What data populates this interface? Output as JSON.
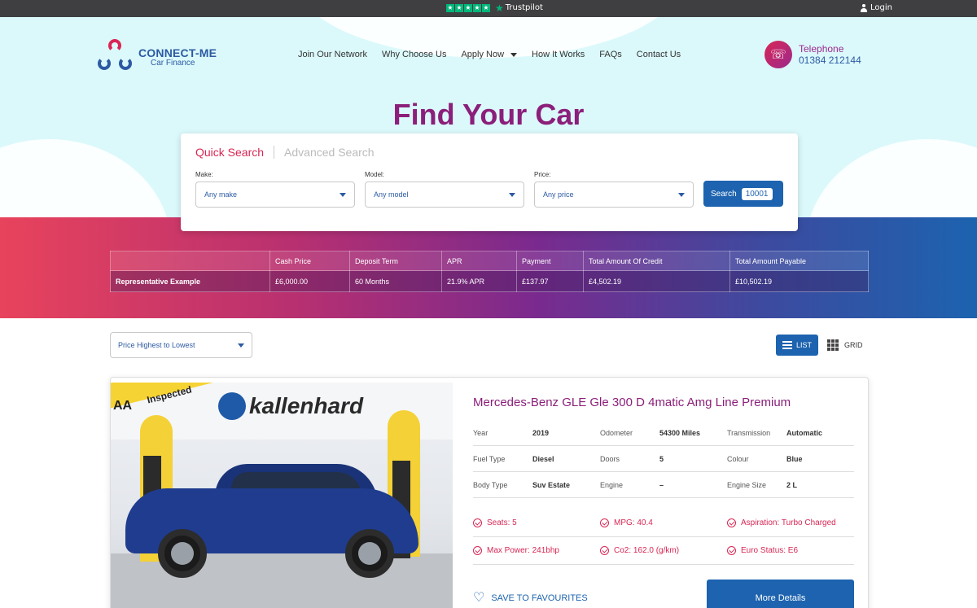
{
  "topbar": {
    "trustpilot": "Trustpilot",
    "login": "Login"
  },
  "brand": {
    "name": "CONNECT-ME",
    "tagline": "Car Finance",
    "colors": {
      "primary_blue": "#1d63af",
      "accent_pink": "#d92654",
      "purple": "#8b1f7a",
      "hero_bg": "#dbf9fb"
    }
  },
  "nav": {
    "items": [
      {
        "label": "Join Our Network"
      },
      {
        "label": "Why Choose Us"
      },
      {
        "label": "Apply Now"
      },
      {
        "label": "How It Works"
      },
      {
        "label": "FAQs"
      },
      {
        "label": "Contact Us"
      }
    ]
  },
  "contact": {
    "label": "Telephone",
    "number": "01384 212144"
  },
  "hero": {
    "title": "Find Your Car"
  },
  "search": {
    "tab_quick": "Quick Search",
    "tab_advanced": "Advanced Search",
    "make_label": "Make:",
    "make_value": "Any make",
    "model_label": "Model:",
    "model_value": "Any model",
    "price_label": "Price:",
    "price_value": "Any price",
    "button_label": "Search",
    "count": "10001"
  },
  "representative": {
    "headers": [
      "",
      "Cash Price",
      "Deposit Term",
      "APR",
      "Payment",
      "Total Amount Of Credit",
      "Total Amount Payable"
    ],
    "row": [
      "Representative Example",
      "£6,000.00",
      "60 Months",
      "21.9% APR",
      "£137.97",
      "£4,502.19",
      "£10,502.19"
    ]
  },
  "toolbar": {
    "sort_value": "Price Highest to Lowest",
    "list_label": "LIST",
    "grid_label": "GRID"
  },
  "listing": {
    "photo_text": {
      "ribbon": "Inspected",
      "badge": "AA",
      "dealer": "kallenhard"
    },
    "title": "Mercedes-Benz GLE Gle 300 D 4matic Amg Line Premium",
    "specs": [
      [
        [
          "Year",
          "2019"
        ],
        [
          "Odometer",
          "54300 Miles"
        ],
        [
          "Transmission",
          "Automatic"
        ]
      ],
      [
        [
          "Fuel Type",
          "Diesel"
        ],
        [
          "Doors",
          "5"
        ],
        [
          "Colour",
          "Blue"
        ]
      ],
      [
        [
          "Body Type",
          "Suv Estate"
        ],
        [
          "Engine",
          "–"
        ],
        [
          "Engine Size",
          "2 L"
        ]
      ]
    ],
    "features": [
      [
        "Seats: 5",
        "MPG: 40.4",
        "Aspiration: Turbo Charged"
      ],
      [
        "Max Power: 241bhp",
        "Co2: 162.0 (g/km)",
        "Euro Status: E6"
      ]
    ],
    "favourite_label": "SAVE TO FAVOURITES",
    "more_label": "More Details"
  }
}
